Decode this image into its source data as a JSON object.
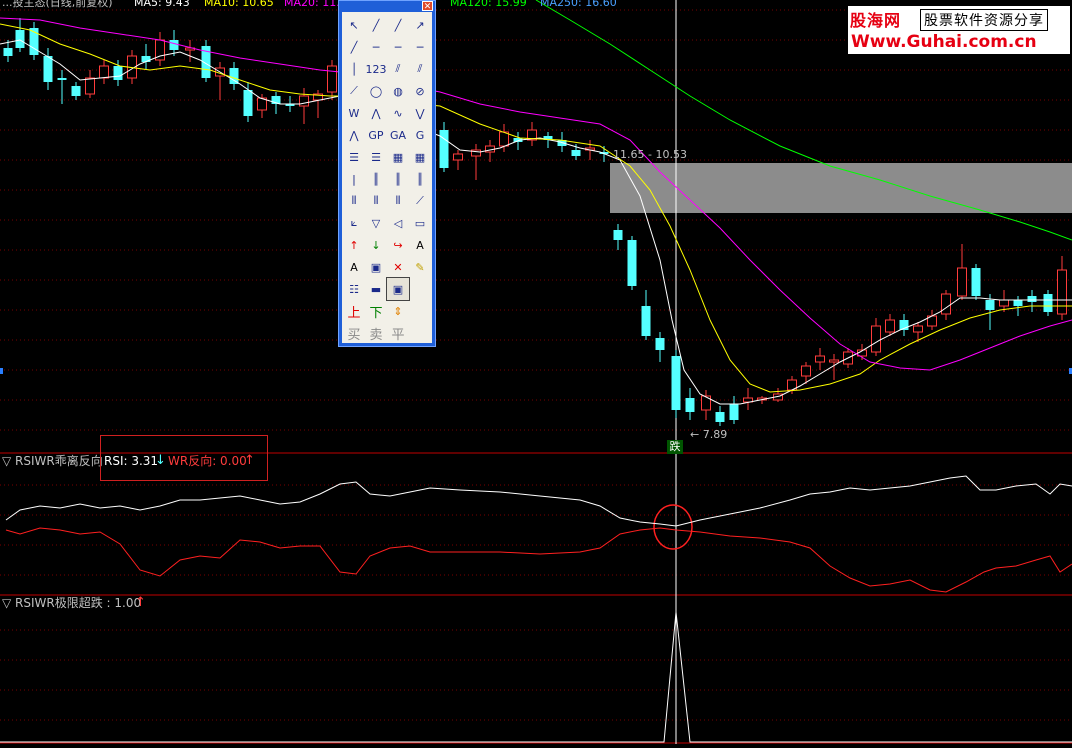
{
  "header": {
    "title_fragment": "...投主态(日线,前复权)",
    "ma5": "MA5: 9.43",
    "ma10": "MA10: 10.65",
    "ma20": "MA20: 11...",
    "ma120": "MA120: 15.99",
    "ma250": "MA250: 16.60"
  },
  "watermark": {
    "site_cn": "股海网",
    "slogan": "股票软件资源分享",
    "url": "Www.Guhai.com.cn"
  },
  "annotations": {
    "range_label": "11.65 - 10.53",
    "low_label": "← 7.89",
    "down_marker": "跌"
  },
  "indicator1": {
    "name": "▽ RSIWR乖离反向",
    "rsi_label": "RSI: 3.31",
    "rsi_arrow": "↓",
    "wr_label": "WR反向: 0.00",
    "wr_arrow": "↑"
  },
  "indicator2": {
    "name": "▽ RSIWR极限超跌 : 1.00",
    "arrow": "↑"
  },
  "toolbar": {
    "close": "✕",
    "buy": "买",
    "sell": "卖",
    "flat": "平",
    "up_label": "上",
    "down_label": "下",
    "text_tool": "A",
    "text_tool2": "A",
    "gp": "GP",
    "ga": "GA",
    "g": "G",
    "num123": "123",
    "delete": "✕"
  },
  "colors": {
    "background": "#000000",
    "up_candle": "#ff3c3c",
    "down_candle": "#54ffff",
    "ma5": "#ffffff",
    "ma10": "#ffff00",
    "ma20": "#ff00ff",
    "ma120": "#00ff00",
    "panel_border": "#c00000"
  }
}
